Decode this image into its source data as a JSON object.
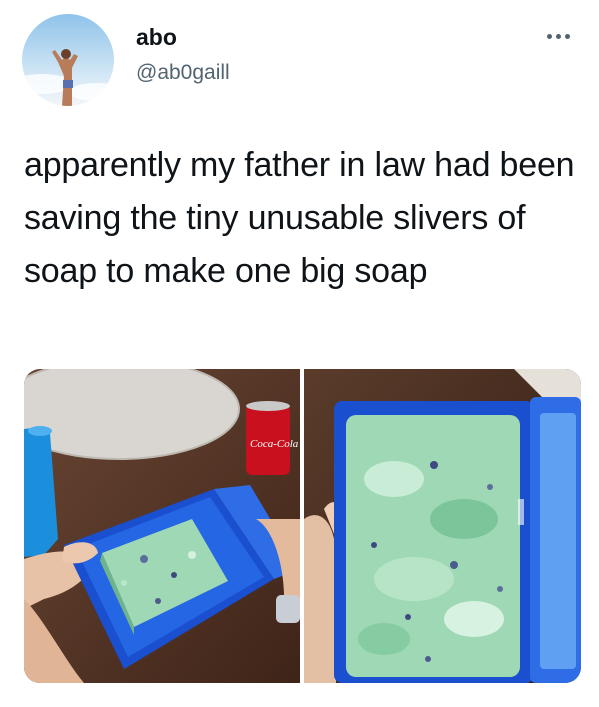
{
  "tweet": {
    "author_name": "abo",
    "author_handle": "@ab0gaill",
    "text": "apparently my father in law had been saving the tiny unusable slivers of soap  to make one big soap",
    "more_icon": "more-horizontal-icon",
    "avatar_icon": "avatar-photo"
  },
  "media": {
    "photos": [
      {
        "label": "photo-1"
      },
      {
        "label": "photo-2"
      }
    ],
    "can_text": "Coca-Cola"
  },
  "colors": {
    "text": "#0f1419",
    "secondary": "#536471",
    "soap_case": "#1a5fd6",
    "soap": "#9fd8b5"
  }
}
